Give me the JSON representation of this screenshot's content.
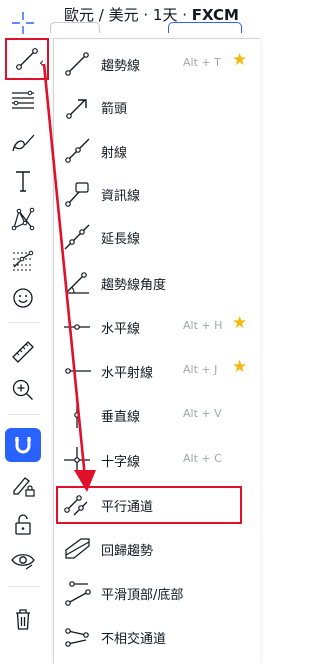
{
  "header": {
    "symbol_text": "歐元 / 美元 · 1天 · ",
    "exchange": "FXCM"
  },
  "toolbar": {
    "items": [
      {
        "name": "crosshair-icon"
      },
      {
        "name": "trend-line-icon"
      },
      {
        "name": "horizontal-lines-icon"
      },
      {
        "name": "brush-icon"
      },
      {
        "name": "text-icon"
      },
      {
        "name": "pattern-icon"
      },
      {
        "name": "prediction-icon"
      },
      {
        "name": "emoji-icon"
      },
      {
        "name": "ruler-icon"
      },
      {
        "name": "zoom-in-icon"
      },
      {
        "name": "magnet-icon"
      },
      {
        "name": "lock-drawing-icon"
      },
      {
        "name": "lock-icon"
      },
      {
        "name": "eye-icon"
      },
      {
        "name": "trash-icon"
      }
    ],
    "expand_glyph": "‹"
  },
  "menu": {
    "items": [
      {
        "label": "趨勢線",
        "hotkey": "Alt + T",
        "favorite": true,
        "icon": "trend-line-icon"
      },
      {
        "label": "箭頭",
        "hotkey": "",
        "favorite": false,
        "icon": "arrow-icon"
      },
      {
        "label": "射線",
        "hotkey": "",
        "favorite": false,
        "icon": "ray-icon"
      },
      {
        "label": "資訊線",
        "hotkey": "",
        "favorite": false,
        "icon": "info-line-icon"
      },
      {
        "label": "延長線",
        "hotkey": "",
        "favorite": false,
        "icon": "extended-line-icon"
      },
      {
        "label": "趨勢線角度",
        "hotkey": "",
        "favorite": false,
        "icon": "trend-angle-icon"
      },
      {
        "label": "水平線",
        "hotkey": "Alt + H",
        "favorite": true,
        "icon": "horizontal-line-icon"
      },
      {
        "label": "水平射線",
        "hotkey": "Alt + J",
        "favorite": true,
        "icon": "horizontal-ray-icon"
      },
      {
        "label": "垂直線",
        "hotkey": "Alt + V",
        "favorite": false,
        "icon": "vertical-line-icon"
      },
      {
        "label": "十字線",
        "hotkey": "Alt + C",
        "favorite": false,
        "icon": "cross-line-icon"
      },
      {
        "label": "平行通道",
        "hotkey": "",
        "favorite": false,
        "icon": "parallel-channel-icon"
      },
      {
        "label": "回歸趨勢",
        "hotkey": "",
        "favorite": false,
        "icon": "regression-trend-icon"
      },
      {
        "label": "平滑頂部/底部",
        "hotkey": "",
        "favorite": false,
        "icon": "flat-top-bottom-icon"
      },
      {
        "label": "不相交通道",
        "hotkey": "",
        "favorite": false,
        "icon": "disjoint-channel-icon"
      }
    ],
    "star_glyph": "★"
  },
  "annotation": {
    "color": "#e0102a",
    "highlighted_item": "平行通道"
  }
}
